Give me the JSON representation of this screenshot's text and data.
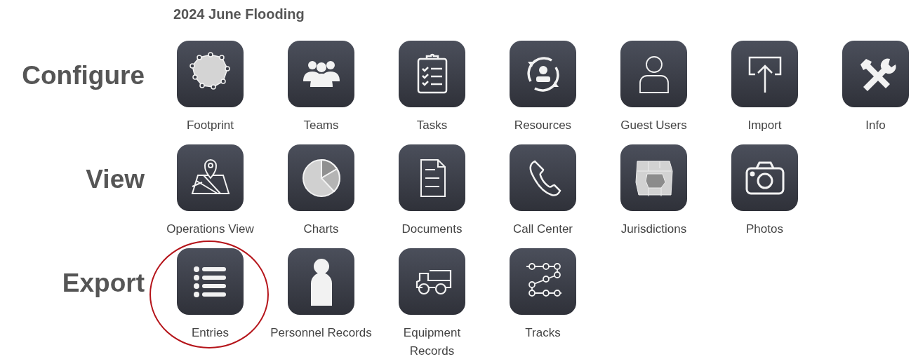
{
  "title": "2024 June Flooding",
  "sections": [
    {
      "label": "Configure",
      "items": [
        {
          "label": "Footprint",
          "highlighted": false
        },
        {
          "label": "Teams",
          "highlighted": false
        },
        {
          "label": "Tasks",
          "highlighted": false
        },
        {
          "label": "Resources",
          "highlighted": false
        },
        {
          "label": "Guest Users",
          "highlighted": false
        },
        {
          "label": "Import",
          "highlighted": false
        },
        {
          "label": "Info",
          "highlighted": false
        }
      ]
    },
    {
      "label": "View",
      "items": [
        {
          "label": "Operations View",
          "highlighted": false
        },
        {
          "label": "Charts",
          "highlighted": false
        },
        {
          "label": "Documents",
          "highlighted": false
        },
        {
          "label": "Call Center",
          "highlighted": false
        },
        {
          "label": "Jurisdictions",
          "highlighted": false
        },
        {
          "label": "Photos",
          "highlighted": false
        }
      ]
    },
    {
      "label": "Export",
      "items": [
        {
          "label": "Entries",
          "highlighted": true
        },
        {
          "label": "Personnel Records",
          "highlighted": false
        },
        {
          "label": "Equipment\nRecords",
          "highlighted": false
        },
        {
          "label": "Tracks",
          "highlighted": false
        }
      ]
    }
  ]
}
